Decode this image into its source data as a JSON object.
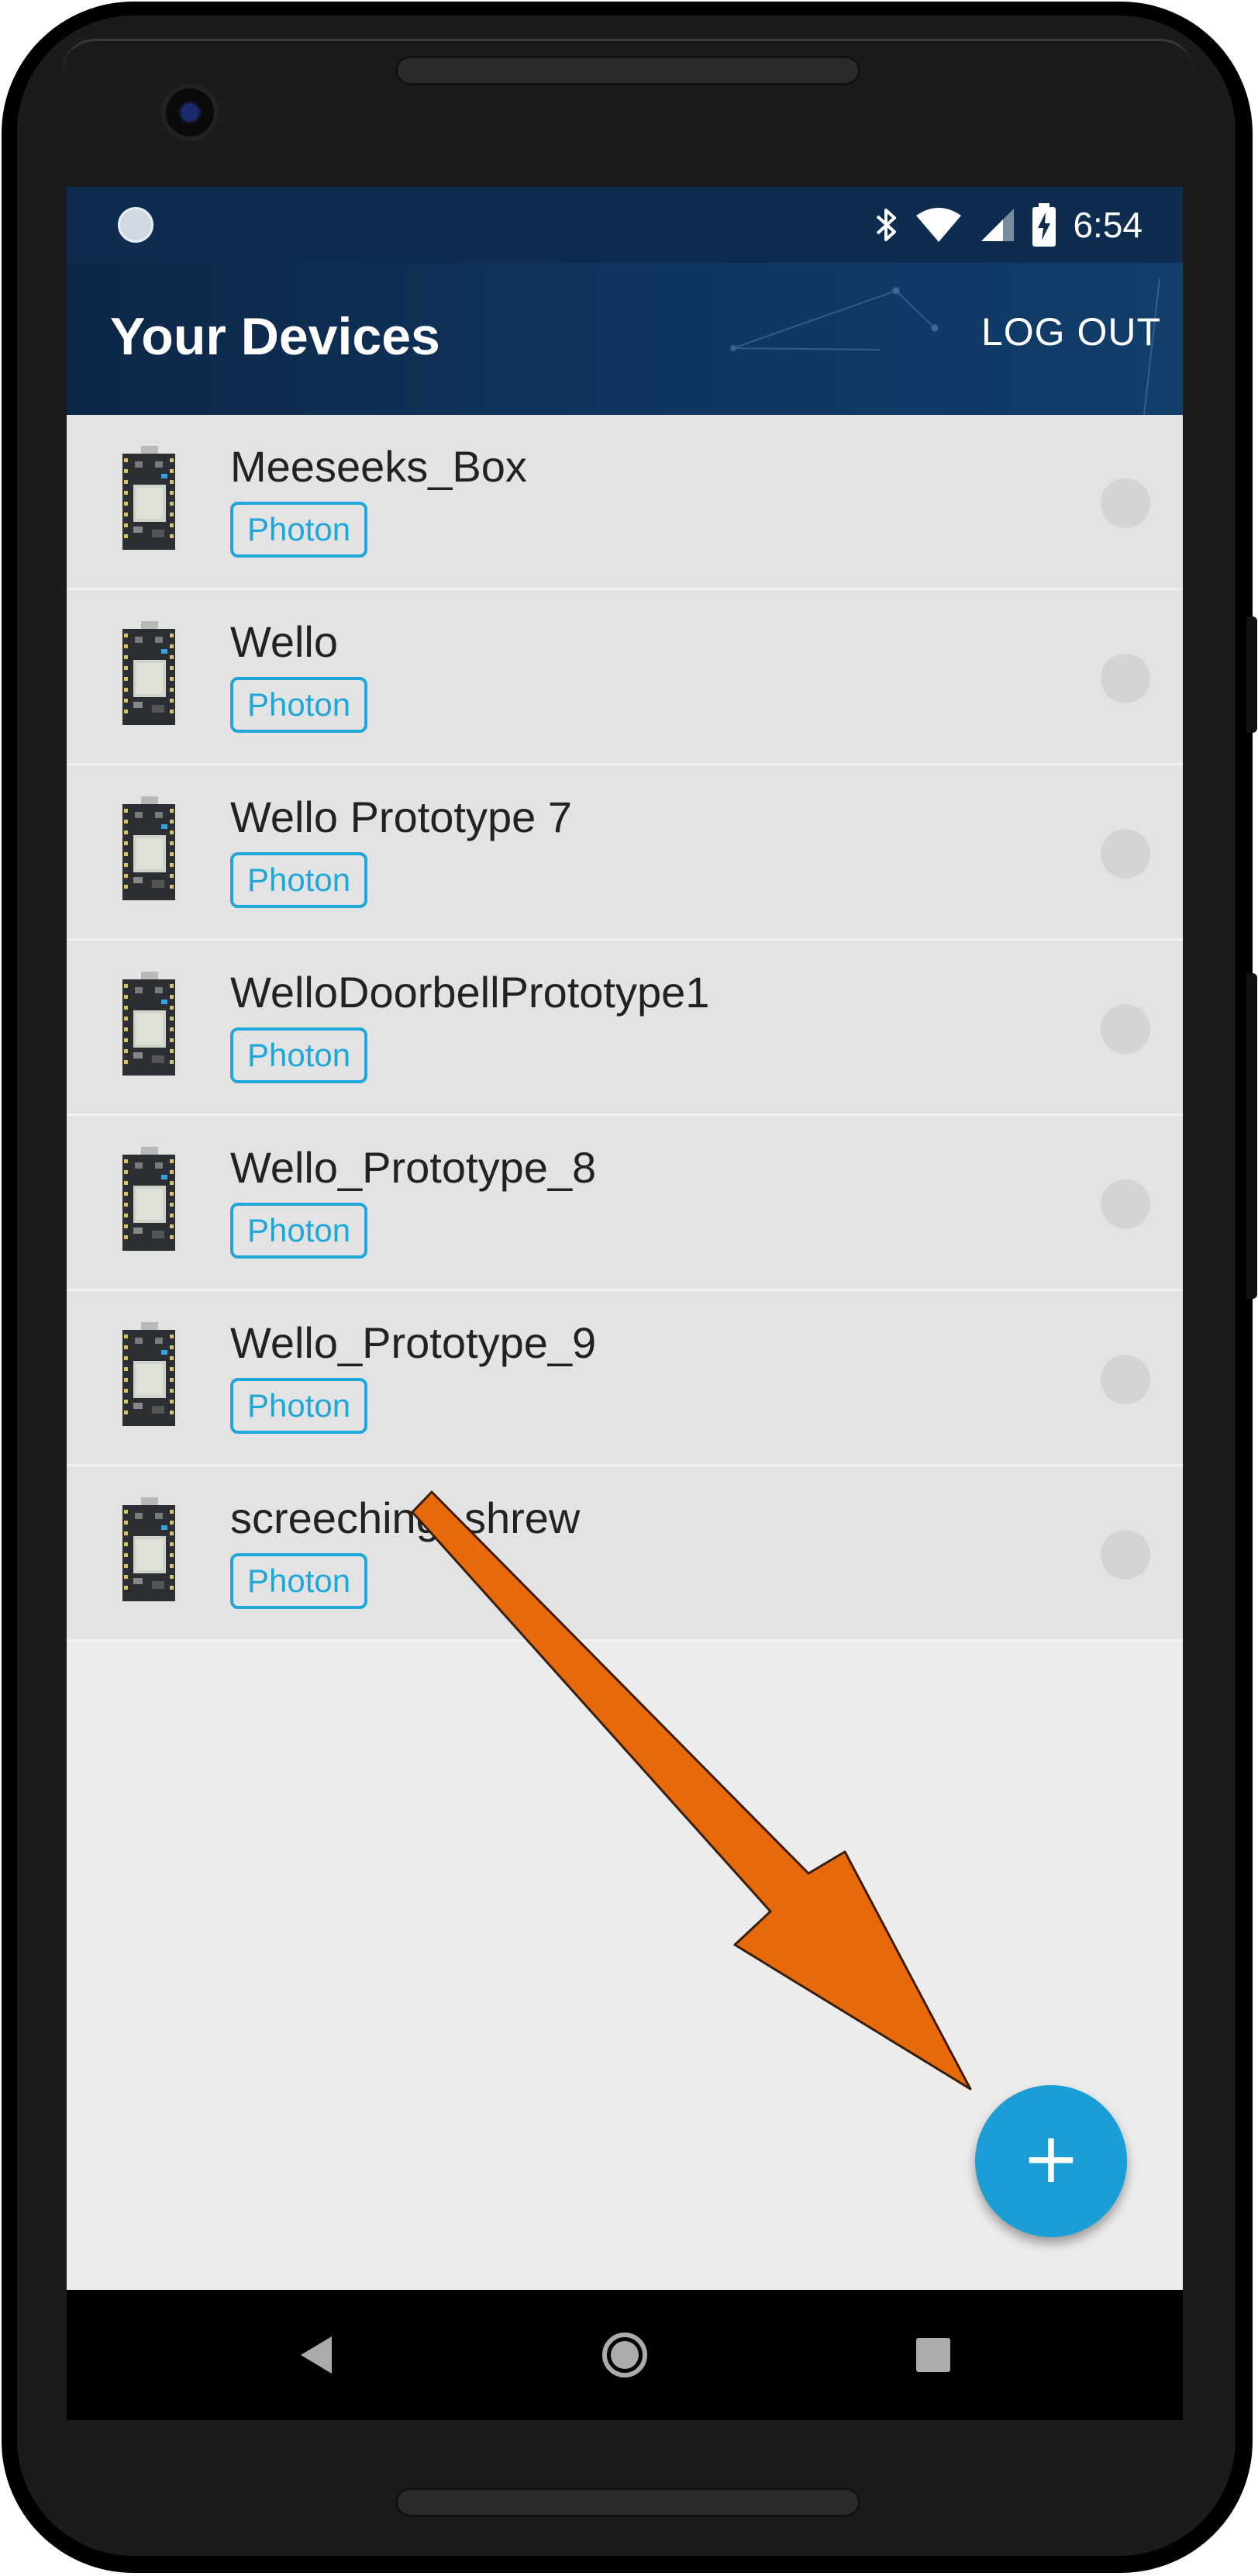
{
  "status_bar": {
    "time": "6:54",
    "icons": [
      "notification-icon",
      "bluetooth-icon",
      "wifi-icon",
      "signal-icon",
      "battery-charging-icon"
    ]
  },
  "app_bar": {
    "title": "Your Devices",
    "logout_label": "LOG OUT"
  },
  "devices": [
    {
      "name": "Meeseeks_Box",
      "type": "Photon"
    },
    {
      "name": "Wello",
      "type": "Photon"
    },
    {
      "name": "Wello Prototype 7",
      "type": "Photon"
    },
    {
      "name": "WelloDoorbellPrototype1",
      "type": "Photon"
    },
    {
      "name": "Wello_Prototype_8",
      "type": "Photon"
    },
    {
      "name": "Wello_Prototype_9",
      "type": "Photon"
    },
    {
      "name": "screeching_shrew",
      "type": "Photon"
    }
  ],
  "fab": {
    "label": "+",
    "icon": "plus-icon"
  },
  "nav_bar": {
    "icons": [
      "back-icon",
      "home-icon",
      "recents-icon"
    ]
  },
  "colors": {
    "app_bar": "#0d2c4f",
    "accent": "#1b9ed6",
    "badge": "#1ea7d8",
    "annotation_arrow": "#e8690a"
  },
  "annotation": {
    "type": "arrow",
    "target": "fab"
  }
}
